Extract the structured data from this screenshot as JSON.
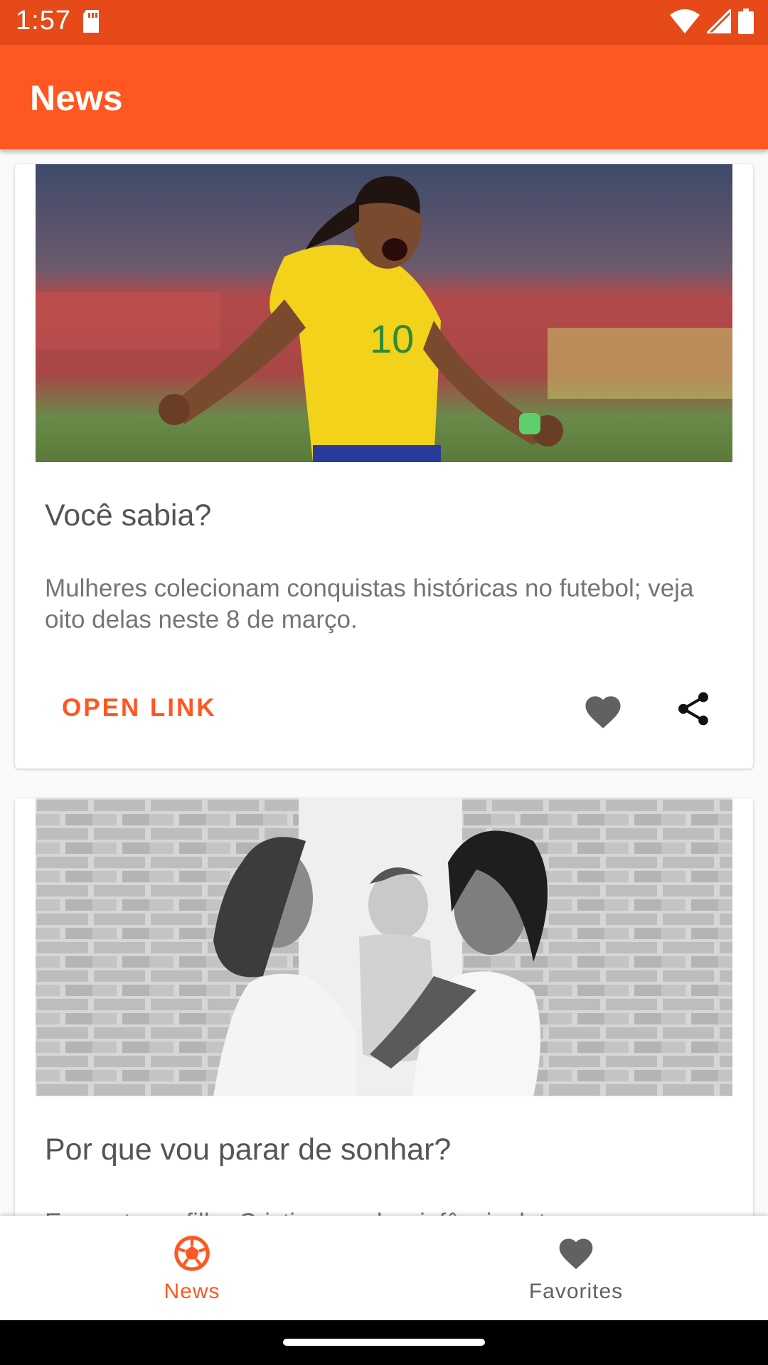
{
  "status_bar": {
    "time": "1:57",
    "icons": [
      "sd-card-icon",
      "wifi-icon",
      "signal-icon",
      "battery-icon"
    ]
  },
  "app_bar": {
    "title": "News"
  },
  "articles": [
    {
      "title": "Você sabia?",
      "description": "Mulheres colecionam conquistas históricas no futebol; veja oito delas neste 8 de março.",
      "open_link_label": "OPEN LINK"
    },
    {
      "title": "Por que vou parar de sonhar?",
      "description": "Em carta ao filho Cristiano, sobre infância, luta"
    }
  ],
  "bottom_nav": {
    "items": [
      {
        "label": "News",
        "icon": "soccer-ball-icon",
        "active": true
      },
      {
        "label": "Favorites",
        "icon": "heart-icon",
        "active": false
      }
    ]
  },
  "colors": {
    "status_bar": "#e64a19",
    "primary": "#ff5722",
    "inactive": "#616161"
  }
}
